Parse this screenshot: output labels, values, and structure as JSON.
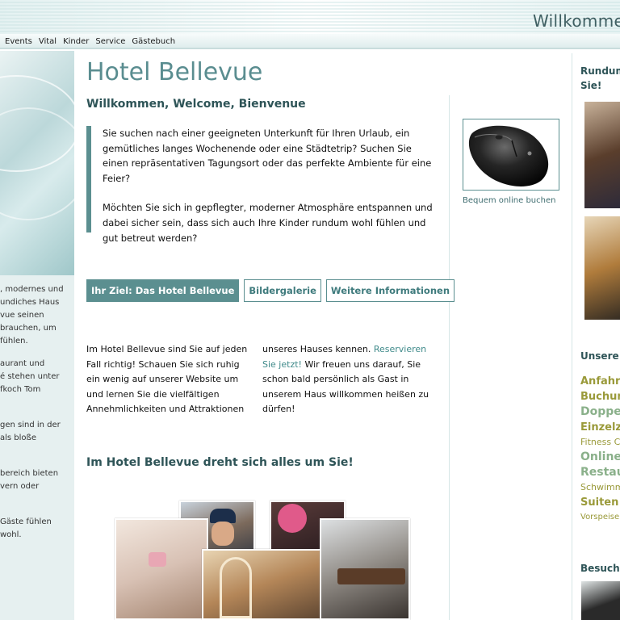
{
  "header": {
    "welcome": "Willkommen"
  },
  "nav": {
    "items": [
      "Events",
      "Vital",
      "Kinder",
      "Service",
      "Gästebuch"
    ]
  },
  "left": {
    "lines": [
      ", modernes und",
      "undiches Haus",
      "vue seinen",
      "brauchen, um",
      "fühlen.",
      "",
      "aurant und",
      "é stehen unter",
      "fkoch Tom",
      "",
      "",
      "gen sind in der",
      "als bloße",
      "",
      "",
      "bereich bieten",
      "vern oder",
      "",
      "",
      "Gäste fühlen",
      "wohl."
    ]
  },
  "main": {
    "title": "Hotel Bellevue",
    "subtitle": "Willkommen, Welcome, Bienvenue",
    "intro_p1": "Sie suchen nach einer geeigneten Unterkunft für Ihren Urlaub, ein gemütliches langes Wochenende oder eine Städtetrip? Suchen Sie einen repräsentativen Tagungsort oder das perfekte Ambiente für eine Feier?",
    "intro_p2": "Möchten Sie sich in gepflegter, moderner Atmosphäre entspannen und dabei sicher sein, dass sich auch Ihre Kinder rundum wohl fühlen und gut betreut werden?",
    "tabs": [
      "Ihr Ziel: Das Hotel Bellevue",
      "Bildergalerie",
      "Weitere Informationen"
    ],
    "body_col1": "Im Hotel Bellevue sind Sie auf jeden Fall richtig! Schauen Sie sich ruhig ein wenig auf unserer Website um und lernen Sie die vielfältigen Annehmlichkeiten und Attraktionen",
    "body_col2_a": "unseres Hauses kennen.",
    "body_col2_link": "Reservieren Sie jetzt!",
    "body_col2_b": "Wir freuen uns darauf, Sie schon bald persönlich als Gast in unserem Haus willkommen heißen zu dürfen!",
    "section_heading": "Im Hotel Bellevue dreht sich alles um Sie!"
  },
  "promo": {
    "caption": "Bequem online buchen",
    "image_icon": "computer-mouse"
  },
  "right": {
    "intro_line1": "Rundum",
    "intro_line2": "Sie!",
    "heading": "Unsere l",
    "links": [
      {
        "text": "Anfahrt",
        "size": "s13"
      },
      {
        "text": "Buchung",
        "size": "s13"
      },
      {
        "text": "Doppel",
        "size": "s14"
      },
      {
        "text": "Einzelz",
        "size": "s13"
      },
      {
        "text": "Fitness C",
        "size": "s11"
      },
      {
        "text": "Online-",
        "size": "s14"
      },
      {
        "text": "Restau",
        "size": "s14"
      },
      {
        "text": "Schwimm",
        "size": "s11"
      },
      {
        "text": "Suiten T",
        "size": "s13"
      },
      {
        "text": "Vorspeise",
        "size": "s10"
      }
    ],
    "heading_2": "Besuche"
  },
  "colors": {
    "accent": "#5b8f90",
    "heading": "#2e5457",
    "link": "#3f8a8a",
    "sidebar_link": "#9a9a3a"
  }
}
